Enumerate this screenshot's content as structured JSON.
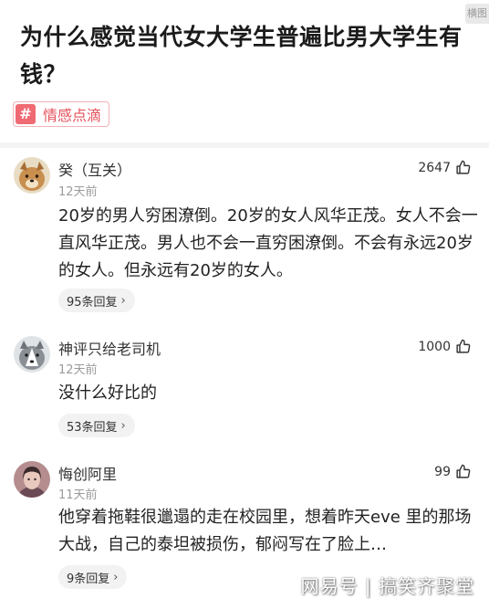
{
  "corner_badge": "横图",
  "question": {
    "title": "为什么感觉当代女大学生普遍比男大学生有钱？"
  },
  "topic_tag": {
    "icon": "hash-icon",
    "label": "情感点滴",
    "color": "#e5525c"
  },
  "comments": [
    {
      "username": "癸（互关）",
      "time": "12天前",
      "likes": "2647",
      "text": "20岁的男人穷困潦倒。20岁的女人风华正茂。女人不会一直风华正茂。男人也不会一直穷困潦倒。不会有永远20岁的女人。但永远有20岁的女人。",
      "replies": "95条回复"
    },
    {
      "username": "神评只给老司机",
      "time": "12天前",
      "likes": "1000",
      "text": "没什么好比的",
      "replies": "53条回复"
    },
    {
      "username": "悔创阿里",
      "time": "11天前",
      "likes": "99",
      "text": "他穿着拖鞋很邋遢的走在校园里，想着昨天eve 里的那场大战，自己的泰坦被损伤，郁闷写在了脸上…",
      "replies": "9条回复"
    }
  ],
  "watermark": "网易号 | 搞笑齐聚堂"
}
